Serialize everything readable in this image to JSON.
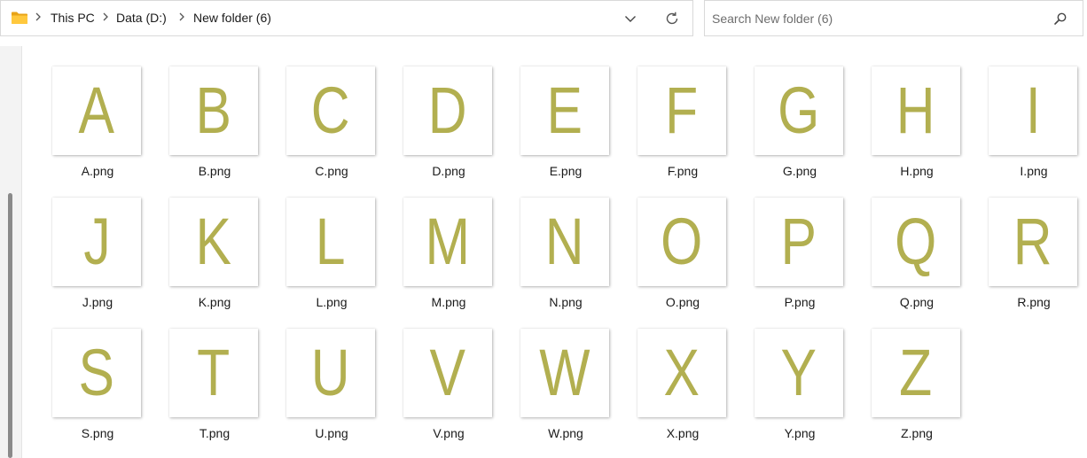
{
  "address_bar": {
    "breadcrumbs": [
      "This PC",
      "Data (D:)",
      "New folder (6)"
    ],
    "icons": {
      "folder": "folder-icon",
      "separator": "chevron-right-icon",
      "dropdown": "chevron-down-icon",
      "refresh": "refresh-icon"
    }
  },
  "search": {
    "placeholder": "Search New folder (6)",
    "icon": "search-icon"
  },
  "colors": {
    "letter": "#b2af50",
    "folder_body": "#ffc83d",
    "folder_tab": "#e8a317"
  },
  "files": [
    {
      "letter": "A",
      "name": "A.png"
    },
    {
      "letter": "B",
      "name": "B.png"
    },
    {
      "letter": "C",
      "name": "C.png"
    },
    {
      "letter": "D",
      "name": "D.png"
    },
    {
      "letter": "E",
      "name": "E.png"
    },
    {
      "letter": "F",
      "name": "F.png"
    },
    {
      "letter": "G",
      "name": "G.png"
    },
    {
      "letter": "H",
      "name": "H.png"
    },
    {
      "letter": "I",
      "name": "I.png"
    },
    {
      "letter": "J",
      "name": "J.png"
    },
    {
      "letter": "K",
      "name": "K.png"
    },
    {
      "letter": "L",
      "name": "L.png"
    },
    {
      "letter": "M",
      "name": "M.png"
    },
    {
      "letter": "N",
      "name": "N.png"
    },
    {
      "letter": "O",
      "name": "O.png"
    },
    {
      "letter": "P",
      "name": "P.png"
    },
    {
      "letter": "Q",
      "name": "Q.png"
    },
    {
      "letter": "R",
      "name": "R.png"
    },
    {
      "letter": "S",
      "name": "S.png"
    },
    {
      "letter": "T",
      "name": "T.png"
    },
    {
      "letter": "U",
      "name": "U.png"
    },
    {
      "letter": "V",
      "name": "V.png"
    },
    {
      "letter": "W",
      "name": "W.png"
    },
    {
      "letter": "X",
      "name": "X.png"
    },
    {
      "letter": "Y",
      "name": "Y.png"
    },
    {
      "letter": "Z",
      "name": "Z.png"
    }
  ]
}
